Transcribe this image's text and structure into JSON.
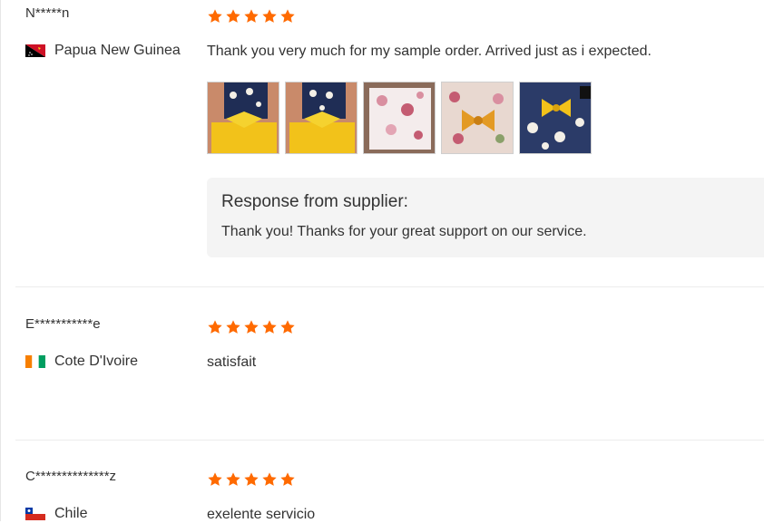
{
  "colors": {
    "star": "#ff6a00",
    "divider": "#ececec",
    "supplier_bg": "#f4f4f4"
  },
  "reviews": [
    {
      "name": "N*****n",
      "country": "Papua New Guinea",
      "flag": "papua-new-guinea-flag",
      "rating": 5,
      "text": "Thank you very much for my sample order. Arrived just as i expected.",
      "photos": [
        "review-photo-1",
        "review-photo-2",
        "review-photo-3",
        "review-photo-4",
        "review-photo-5"
      ],
      "supplier_response": {
        "title": "Response from supplier:",
        "text": "Thank you! Thanks for your great support on our service."
      }
    },
    {
      "name": "E***********e",
      "country": "Cote D'Ivoire",
      "flag": "cote-divoire-flag",
      "rating": 5,
      "text": "satisfait"
    },
    {
      "name": "C**************z",
      "country": "Chile",
      "flag": "chile-flag",
      "rating": 5,
      "text": "exelente servicio"
    }
  ]
}
